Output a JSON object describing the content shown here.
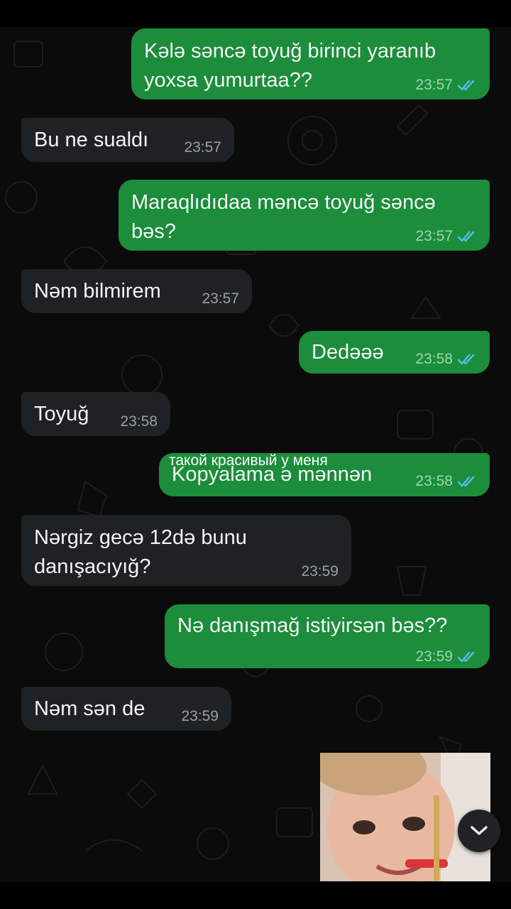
{
  "messages": [
    {
      "direction": "out",
      "lines": [
        "Kələ səncə toyuğ birinci yaranıb",
        "yoxsa yumurtaa??"
      ],
      "time": "23:57",
      "status": "read"
    },
    {
      "direction": "in",
      "lines": [
        "Bu ne sualdı"
      ],
      "time": "23:57"
    },
    {
      "direction": "out",
      "lines": [
        "Maraqlıdıdaa məncə toyuğ səncə",
        "bəs?"
      ],
      "time": "23:57",
      "status": "read"
    },
    {
      "direction": "in",
      "lines": [
        "Nəm bilmirem"
      ],
      "time": "23:57"
    },
    {
      "direction": "out",
      "lines": [
        "Dedəəə"
      ],
      "time": "23:58",
      "status": "read"
    },
    {
      "direction": "in",
      "lines": [
        "Toyuğ"
      ],
      "time": "23:58"
    },
    {
      "direction": "out",
      "lines": [
        "Kopyalama ə mənnən"
      ],
      "time": "23:58",
      "status": "read"
    },
    {
      "direction": "in",
      "lines": [
        "Nərgiz gecə 12də bunu",
        "danışacıyığ?"
      ],
      "time": "23:59"
    },
    {
      "direction": "out",
      "lines": [
        "Nə danışmağ istiyirsən bəs??"
      ],
      "time": "23:59",
      "status": "read"
    },
    {
      "direction": "in",
      "lines": [
        "Nəm sən de"
      ],
      "time": "23:59"
    }
  ],
  "overlay_caption": "такой красивый у меня",
  "icons": {
    "read_receipt": "double-check-icon",
    "scroll_down": "chevron-down-icon"
  },
  "colors": {
    "outgoing": "#1b8d3b",
    "incoming": "#1e2224",
    "background": "#0b0b0b",
    "read_tick": "#53bdeb"
  }
}
